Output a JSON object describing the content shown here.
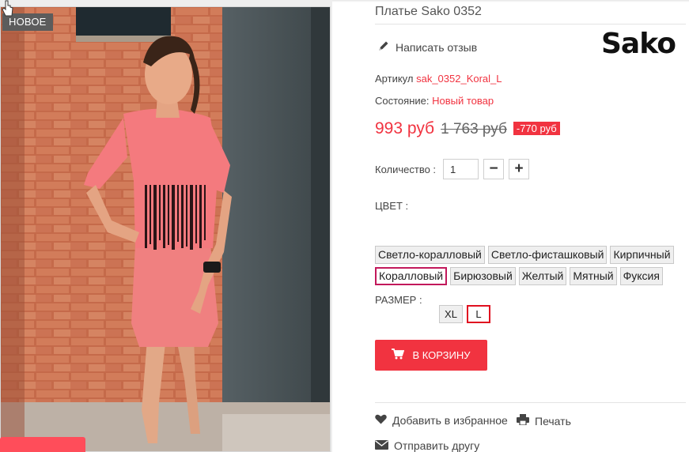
{
  "photo": {
    "badge": "НОВОЕ",
    "alt": "Платье Sako 0352 product photo"
  },
  "product": {
    "title": "Платье Sako 0352",
    "brand": "Sako",
    "write_review": "Написать отзыв",
    "sku_label": "Артикул",
    "sku_value": "sak_0352_Koral_L",
    "condition_label": "Состояние:",
    "condition_value": "Новый товар",
    "price": "993 руб",
    "old_price": "1 763 руб",
    "discount": "-770 руб",
    "quantity_label": "Количество :",
    "quantity_value": "1",
    "minus_label": "−",
    "plus_label": "+",
    "color_label": "ЦВЕТ :",
    "colors_row1": [
      "Светло-коралловый",
      "Светло-фисташковый",
      "Кирпичный"
    ],
    "colors_row2": [
      "Коралловый",
      "Бирюзовый",
      "Желтый",
      "Мятный",
      "Фуксия"
    ],
    "selected_color": "Коралловый",
    "size_label": "РАЗМЕР :",
    "sizes": [
      "XL",
      "L"
    ],
    "selected_size": "L",
    "cart_button": "В КОРЗИНУ",
    "add_favorites": "Добавить в избранное",
    "print": "Печать",
    "send_friend": "Отправить другу"
  },
  "colors": {
    "accent": "#f13340",
    "selected_color_border": "#c2185b",
    "selected_size_border": "#e01020",
    "badge_bg": "#5c5c5c"
  },
  "icons": [
    "pencil-icon",
    "cart-icon",
    "heart-icon",
    "printer-icon",
    "envelope-icon",
    "cursor-icon"
  ]
}
